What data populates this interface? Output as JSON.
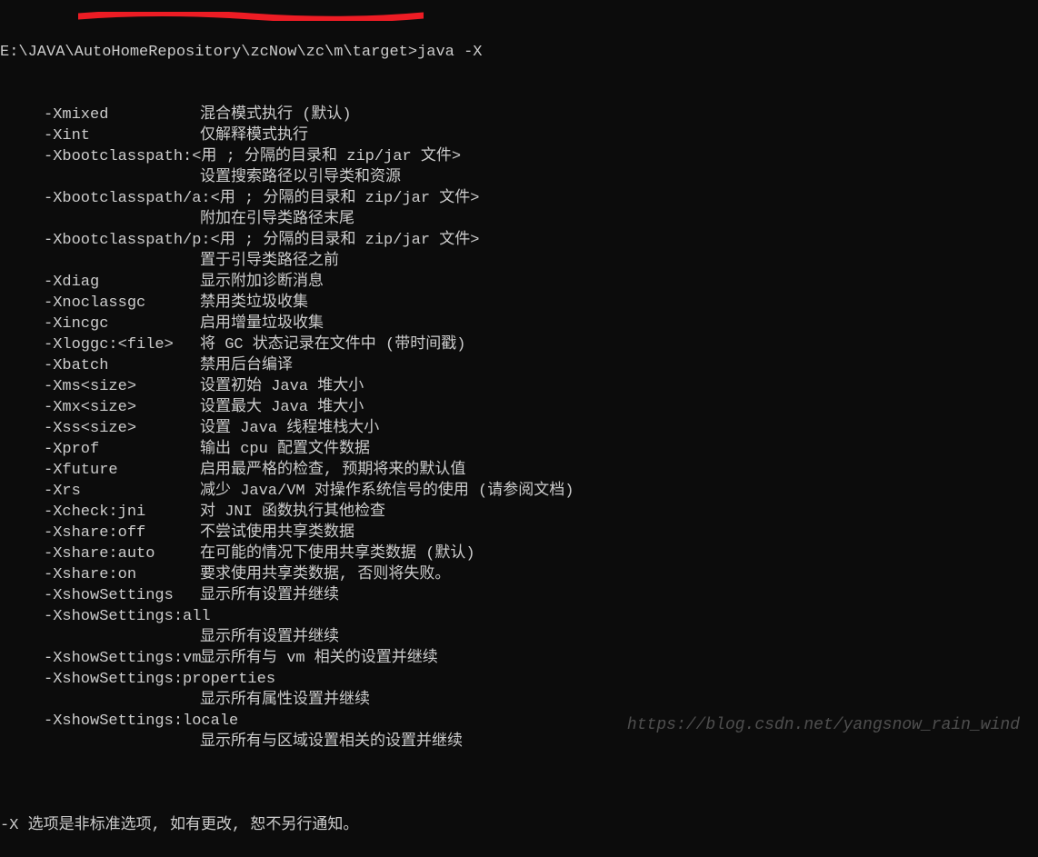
{
  "prompt": "E:\\JAVA\\AutoHomeRepository\\zcNow\\zc\\m\\target>java -X",
  "options": [
    {
      "flag": "-Xmixed",
      "desc": "混合模式执行 (默认)"
    },
    {
      "flag": "-Xint",
      "desc": "仅解释模式执行"
    },
    {
      "flag": "-Xbootclasspath:",
      "arg": "<用 ; 分隔的目录和 zip/jar 文件>",
      "cont": "设置搜索路径以引导类和资源"
    },
    {
      "flag": "-Xbootclasspath/a:",
      "arg": "<用 ; 分隔的目录和 zip/jar 文件>",
      "cont": "附加在引导类路径末尾"
    },
    {
      "flag": "-Xbootclasspath/p:",
      "arg": "<用 ; 分隔的目录和 zip/jar 文件>",
      "cont": "置于引导类路径之前"
    },
    {
      "flag": "-Xdiag",
      "desc": "显示附加诊断消息"
    },
    {
      "flag": "-Xnoclassgc",
      "desc": "禁用类垃圾收集"
    },
    {
      "flag": "-Xincgc",
      "desc": "启用增量垃圾收集"
    },
    {
      "flag": "-Xloggc:<file>",
      "desc": "将 GC 状态记录在文件中 (带时间戳)"
    },
    {
      "flag": "-Xbatch",
      "desc": "禁用后台编译"
    },
    {
      "flag": "-Xms<size>",
      "desc": "设置初始 Java 堆大小"
    },
    {
      "flag": "-Xmx<size>",
      "desc": "设置最大 Java 堆大小"
    },
    {
      "flag": "-Xss<size>",
      "desc": "设置 Java 线程堆栈大小"
    },
    {
      "flag": "-Xprof",
      "desc": "输出 cpu 配置文件数据"
    },
    {
      "flag": "-Xfuture",
      "desc": "启用最严格的检查, 预期将来的默认值"
    },
    {
      "flag": "-Xrs",
      "desc": "减少 Java/VM 对操作系统信号的使用 (请参阅文档)"
    },
    {
      "flag": "-Xcheck:jni",
      "desc": "对 JNI 函数执行其他检查"
    },
    {
      "flag": "-Xshare:off",
      "desc": "不尝试使用共享类数据"
    },
    {
      "flag": "-Xshare:auto",
      "desc": "在可能的情况下使用共享类数据 (默认)"
    },
    {
      "flag": "-Xshare:on",
      "desc": "要求使用共享类数据, 否则将失败。"
    },
    {
      "flag": "-XshowSettings",
      "desc": "显示所有设置并继续"
    },
    {
      "flag": "-XshowSettings:all",
      "cont": "显示所有设置并继续"
    },
    {
      "flag": "-XshowSettings:vm",
      "desc": "显示所有与 vm 相关的设置并继续"
    },
    {
      "flag": "-XshowSettings:properties",
      "cont": "显示所有属性设置并继续"
    },
    {
      "flag": "-XshowSettings:locale",
      "cont": "显示所有与区域设置相关的设置并继续"
    }
  ],
  "note": "-X 选项是非标准选项, 如有更改, 恕不另行通知。",
  "watermark": "https://blog.csdn.net/yangsnow_rain_wind"
}
